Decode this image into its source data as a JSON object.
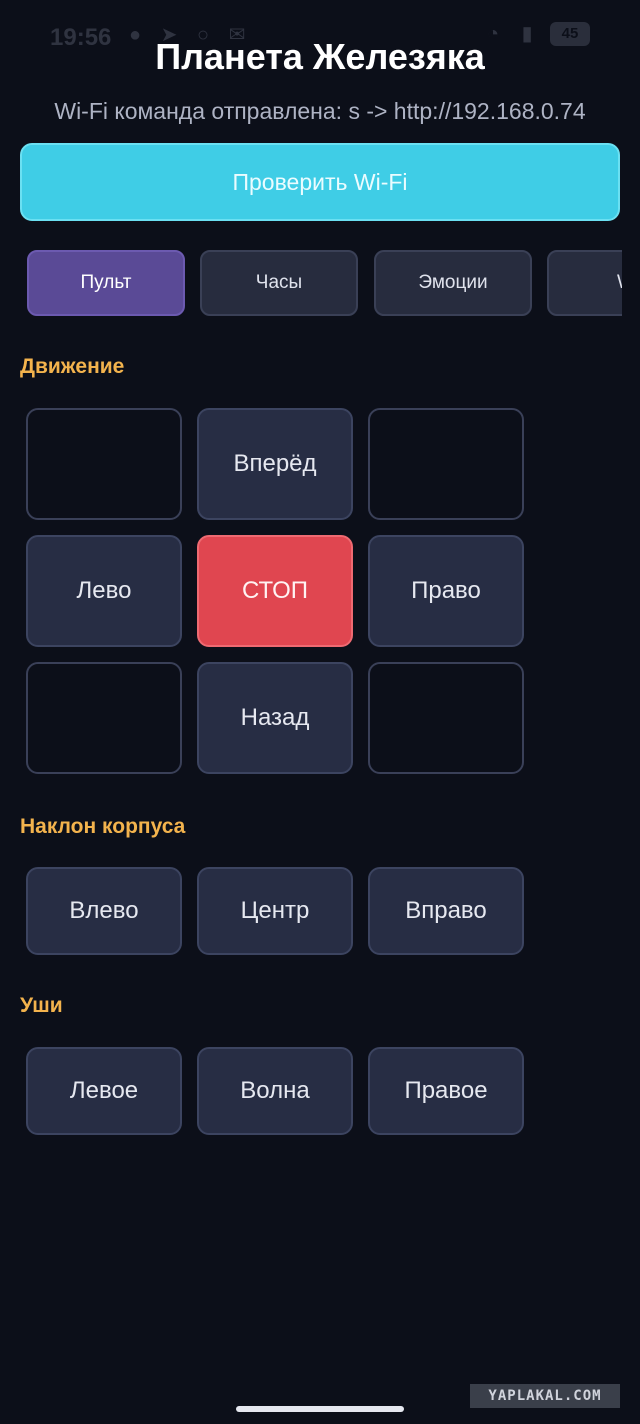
{
  "status_bar": {
    "time": "19:56",
    "battery": "45",
    "icons": [
      "chat-icon",
      "send-icon",
      "circle-icon",
      "mail-icon"
    ]
  },
  "header": {
    "title": "Планета Железяка",
    "wifi_status": "Wi-Fi команда отправлена: s -> http://192.168.0.74"
  },
  "wifi_check": {
    "label": "Проверить Wi-Fi"
  },
  "tabs": [
    {
      "label": "Пульт",
      "active": true
    },
    {
      "label": "Часы",
      "active": false
    },
    {
      "label": "Эмоции",
      "active": false
    },
    {
      "label": "W",
      "active": false
    }
  ],
  "movement": {
    "title": "Движение",
    "forward": "Вперёд",
    "left": "Лево",
    "stop": "СТОП",
    "right": "Право",
    "back": "Назад"
  },
  "tilt": {
    "title": "Наклон корпуса",
    "left": "Влево",
    "center": "Центр",
    "right": "Вправо"
  },
  "ears": {
    "title": "Уши",
    "left": "Левое",
    "wave": "Волна",
    "right": "Правое"
  },
  "watermark": "YAPLAKAL.COM",
  "colors": {
    "background": "#0c0f19",
    "accent_cyan": "#3fcde6",
    "active_tab": "#5a4a96",
    "stop_red": "#e04650",
    "section_orange": "#f3b34d"
  }
}
